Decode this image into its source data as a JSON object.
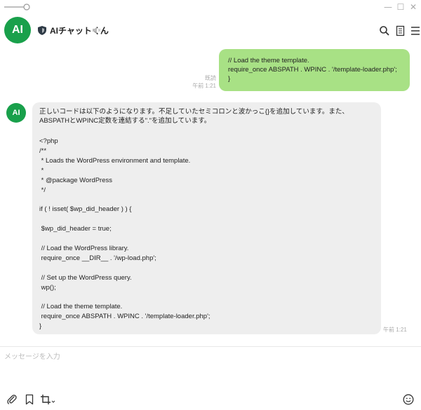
{
  "window": {
    "minimize_glyph": "—",
    "maximize_glyph": "☐",
    "close_glyph": "✕"
  },
  "header": {
    "avatar_text": "AI",
    "title": "AIチャットくん",
    "icons": [
      "shield-icon",
      "mute-icon",
      "search-icon",
      "note-icon",
      "menu-icon"
    ]
  },
  "messages": {
    "user": {
      "text": "// Load the theme template.\nrequire_once ABSPATH . WPINC . '/template-loader.php';\n}",
      "read_label": "既読",
      "time": "午前 1:21"
    },
    "bot": {
      "avatar_text": "AI",
      "intro": "正しいコードは以下のようになります。不足していたセミコロンと波かっこ{}を追加しています。また、ABSPATHとWPINC定数を連結する\".\"を追加しています。",
      "code": "<?php\n/**\n * Loads the WordPress environment and template.\n *\n * @package WordPress\n */\n\nif ( ! isset( $wp_did_header ) ) {\n\n $wp_did_header = true;\n\n // Load the WordPress library.\n require_once __DIR__ . '/wp-load.php';\n\n // Set up the WordPress query.\n wp();\n\n // Load the theme template.\n require_once ABSPATH . WPINC . '/template-loader.php';\n}",
      "time": "午前 1:21"
    }
  },
  "composer": {
    "placeholder": "メッセージを入力",
    "icons": [
      "attach-icon",
      "bookmark-icon",
      "crop-icon",
      "emoji-icon"
    ]
  },
  "colors": {
    "brand_green": "#19a04b",
    "user_bubble": "#a8e185",
    "bot_bubble": "#eeeeee"
  }
}
